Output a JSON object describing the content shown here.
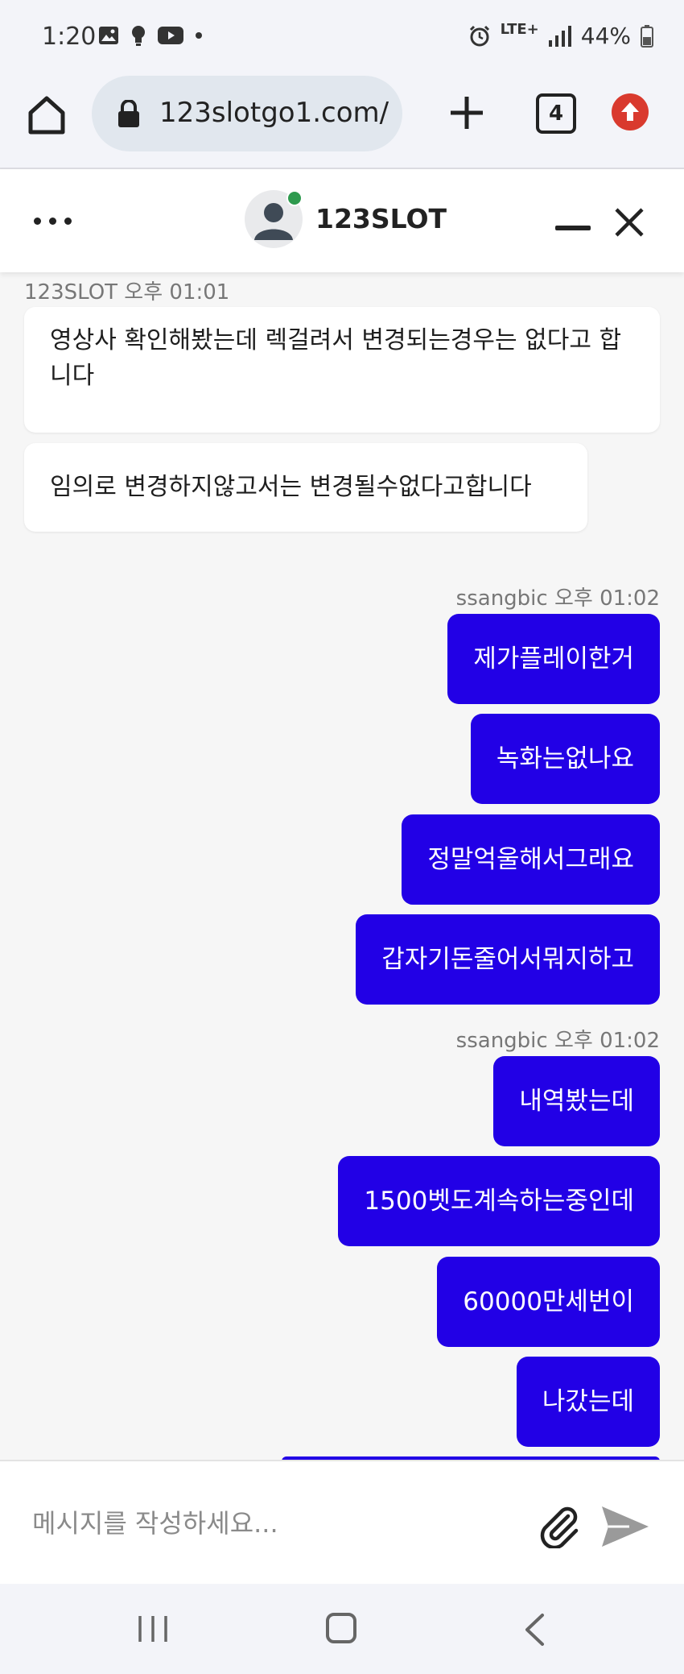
{
  "status_bar": {
    "time": "1:20",
    "network": "LTE+",
    "battery": "44%"
  },
  "browser": {
    "url": "123slotgo1.com/",
    "tab_count": "4"
  },
  "chat": {
    "title": "123SLOT",
    "incoming": {
      "meta": "123SLOT 오후 01:01",
      "messages": [
        "영상사 확인해봤는데 렉걸려서 변경되는경우는 없다고 합니다",
        "임의로 변경하지않고서는 변경될수없다고합니다"
      ]
    },
    "outgoing_groups": [
      {
        "meta": "ssangbic 오후 01:02",
        "messages": [
          "제가플레이한거",
          "녹화는없나요",
          "정말억울해서그래요",
          "갑자기돈줄어서뭐지하고"
        ]
      },
      {
        "meta": "ssangbic 오후 01:02",
        "messages": [
          "내역봤는데",
          "1500벳도계속하는중인데",
          "60000만세번이",
          "나갔는데"
        ]
      }
    ]
  },
  "composer": {
    "placeholder": "메시지를 작성하세요..."
  },
  "colors": {
    "outgoing_bubble": "#2200e6",
    "online": "#2e9a4e",
    "update_badge": "#d93a2e"
  }
}
